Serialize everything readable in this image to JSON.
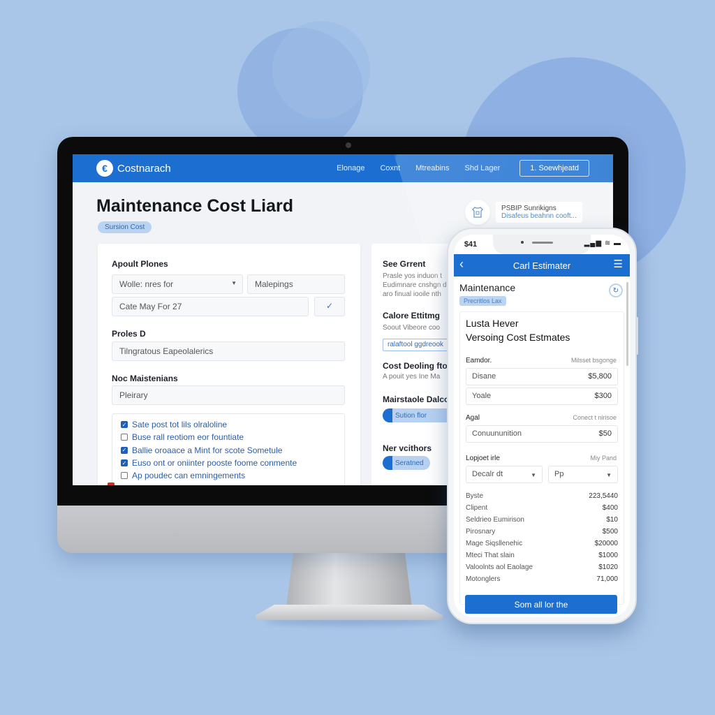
{
  "desktop": {
    "navbar": {
      "app_name": "Costnarach",
      "logo_glyph": "€",
      "links": [
        "Elonage",
        "Coxnt",
        "Mtreabins",
        "Shd Lager"
      ],
      "cta_label": "1. Soewhjeatd"
    },
    "page_title": "Maintenance Cost Liard",
    "title_badge": "Sursion Cost",
    "promo": {
      "icon": "shirt-icon",
      "title": "PSBIP Sunrikigns",
      "subtitle": "Disafeus beahnn cooft..."
    },
    "form_card": {
      "section1_label": "Apoult Plones",
      "select1_value": "Wolle: nres for",
      "field2_value": "Malepings",
      "date_value": "Cate May For 27",
      "date_icon": "check-icon",
      "section2_label": "Proles D",
      "field3_value": "Tilngratous Eapeolalerics",
      "section3_label": "Noc Maistenians",
      "field4_value": "Pleirary",
      "checklist": [
        {
          "label": "Sate post tot lils olraloline",
          "checked": true
        },
        {
          "label": "Buse rall reotiom eor fountiate",
          "checked": false
        },
        {
          "label": "Ballie oroaace a Mint for scote Sometule",
          "checked": true
        },
        {
          "label": "Euso ont or oniinter pooste foome conmente",
          "checked": true
        },
        {
          "label": "Ap poudec can emningements",
          "checked": false
        }
      ]
    },
    "side_card": {
      "heading1": "See Grrent",
      "text1": [
        "Prasle yos induon t",
        "Eudimnare cnshgn d",
        "aro finual iooile nth"
      ],
      "heading2": "Calore Ettitmg",
      "text2": "Soout Vibeore coo",
      "outline_label": "ralaftool ggdreook",
      "heading3": "Cost Deoling fto",
      "text3": "A pouit yes Ine Ma",
      "heading4": "Mairstaole Dalcoo",
      "toggle1_label": "Sution flor",
      "heading5": "Ner vcithors",
      "toggle2_label": "Seratned"
    }
  },
  "phone": {
    "status_time": "$41",
    "status_icons": "▂▄▆ ≋ ▬",
    "header_title": "Carl Estimater",
    "back_icon": "‹",
    "menu_icon": "☰",
    "title": "Maintenance",
    "badge": "Precritlos Lax",
    "ring_icon": "↻",
    "card_title_line1": "Lusta Hever",
    "card_title_line2": "Versoing Cost Estmates",
    "group1_label": "Eamdor.",
    "group1_right": "Milsset bsgonge",
    "group1_rows": [
      {
        "label": "Disane",
        "amount": "$5,800"
      },
      {
        "label": "Yoale",
        "amount": "$300"
      }
    ],
    "group2_label": "Agal",
    "group2_right": "Conect t nirisoe",
    "group2_rows": [
      {
        "label": "Conuununition",
        "amount": "$50"
      }
    ],
    "group3_label": "Lopjoet irle",
    "group3_right": "Miy Pand",
    "select1": "Decalr dt",
    "select2": "Pp",
    "line_items": [
      {
        "label": "Byste",
        "value": "223,5440"
      },
      {
        "label": "Clipent",
        "value": "$400"
      },
      {
        "label": "Seldrieo Eumirison",
        "value": "$10"
      },
      {
        "label": "Pirosnary",
        "value": "$500"
      },
      {
        "label": "Mage Siqsllenehic",
        "value": "$20000"
      },
      {
        "label": "Mteci That slain",
        "value": "$1000"
      },
      {
        "label": "Valoolnts aol Eaolage",
        "value": "$1020"
      },
      {
        "label": "Motonglers",
        "value": "71,000"
      }
    ],
    "button_label": "Som all lor the"
  },
  "colors": {
    "brand_blue": "#1c6fd1",
    "background": "#a9c6e8",
    "badge_bg": "#b9d4f2"
  }
}
